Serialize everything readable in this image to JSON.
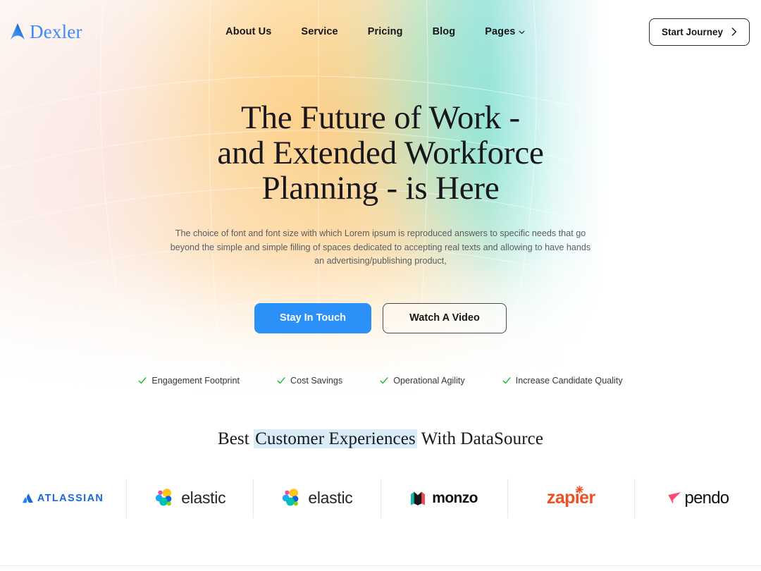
{
  "brand": {
    "name": "Dexler",
    "mark": "triangle-arrow-logo-icon",
    "color": "#3d8bfd"
  },
  "nav": {
    "items": [
      {
        "label": "About Us",
        "has_dropdown": false
      },
      {
        "label": "Service",
        "has_dropdown": false
      },
      {
        "label": "Pricing",
        "has_dropdown": false
      },
      {
        "label": "Blog",
        "has_dropdown": false
      },
      {
        "label": "Pages",
        "has_dropdown": true
      }
    ],
    "cta": {
      "label": "Start Journey",
      "icon": "chevron-right-icon"
    }
  },
  "hero": {
    "title_line_1": "The Future of Work -",
    "title_line_2": "and Extended Workforce",
    "title_line_3": "Planning - is Here",
    "subtitle": "The choice of font and font size with which Lorem ipsum is reproduced answers to specific needs that go beyond the simple and simple filling of spaces dedicated to accepting real texts and allowing to have hands an advertising/publishing product,",
    "primary_button": "Stay In Touch",
    "secondary_button": "Watch A Video",
    "features": [
      {
        "label": "Engagement Footprint",
        "icon": "check-icon"
      },
      {
        "label": "Cost Savings",
        "icon": "check-icon"
      },
      {
        "label": "Operational Agility",
        "icon": "check-icon"
      },
      {
        "label": "Increase Candidate Quality",
        "icon": "check-icon"
      }
    ],
    "check_color": "#19b526",
    "primary_color": "#2b90f8"
  },
  "proof": {
    "title_pre": "Best ",
    "title_highlight": "Customer Experiences",
    "title_post": " With DataSource",
    "highlight_color": "#d8edf8",
    "logos": [
      {
        "name": "ATLASSIAN",
        "id": "atlassian-logo",
        "color": "#1868db"
      },
      {
        "name": "elastic",
        "id": "elastic-logo",
        "color": "#22252a"
      },
      {
        "name": "elastic",
        "id": "elastic-logo",
        "color": "#22252a"
      },
      {
        "name": "monzo",
        "id": "monzo-logo",
        "color": "#0f1012"
      },
      {
        "name": "zapier",
        "id": "zapier-logo",
        "color": "#f04e23"
      },
      {
        "name": "pendo",
        "id": "pendo-logo",
        "color": "#0f1012"
      }
    ]
  }
}
